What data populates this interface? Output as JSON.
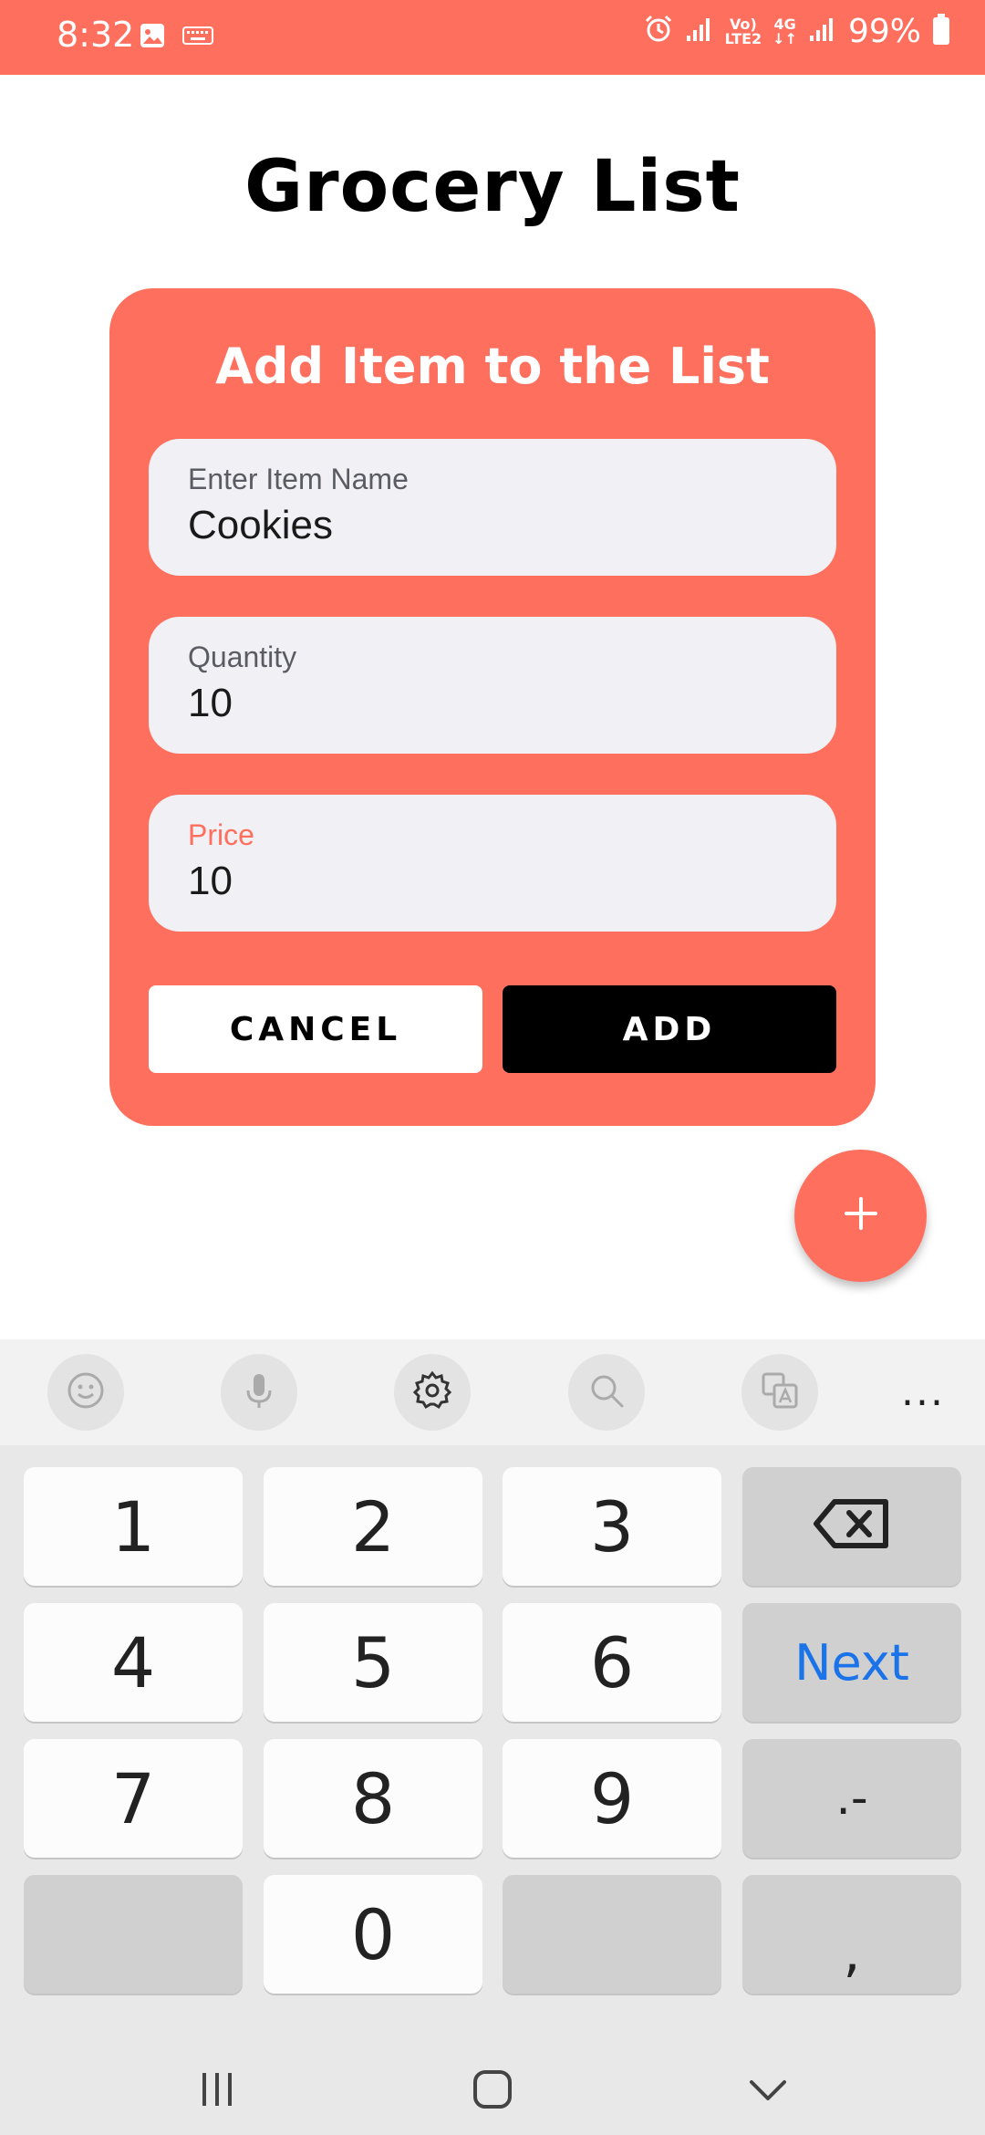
{
  "status_bar": {
    "time": "8:32",
    "network_top": "Vo)",
    "network_bottom": "LTE2",
    "network_type": "4G",
    "battery": "99%"
  },
  "page": {
    "title": "Grocery List"
  },
  "dialog": {
    "title": "Add Item to the List",
    "fields": {
      "item_name": {
        "label": "Enter Item Name",
        "value": "Cookies"
      },
      "quantity": {
        "label": "Quantity",
        "value": "10"
      },
      "price": {
        "label": "Price",
        "value": "10"
      }
    },
    "cancel_label": "CANCEL",
    "add_label": "ADD"
  },
  "fab": {
    "icon": "plus-icon"
  },
  "keyboard": {
    "toolbar": {
      "icons": [
        "emoji-icon",
        "mic-icon",
        "settings-icon",
        "search-icon",
        "translate-icon",
        "more-icon"
      ],
      "more_label": "..."
    },
    "keys": {
      "k1": "1",
      "k2": "2",
      "k3": "3",
      "k4": "4",
      "k5": "5",
      "k6": "6",
      "k7": "7",
      "k8": "8",
      "k9": "9",
      "k0": "0",
      "next": "Next",
      "dot_dash": ".-",
      "comma": ","
    }
  },
  "colors": {
    "accent": "#ff6f5e",
    "field_bg": "#f1f0f5",
    "next_key": "#1a73e8"
  }
}
